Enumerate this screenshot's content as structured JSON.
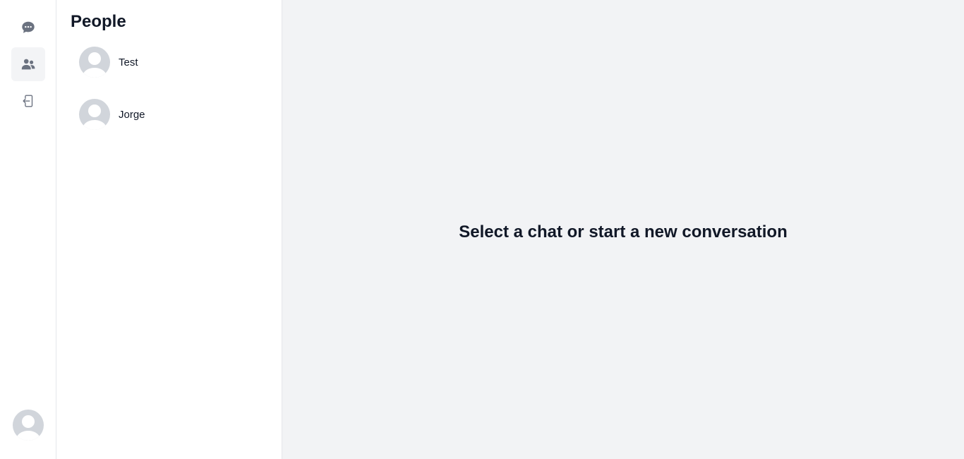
{
  "rail": {
    "items": [
      {
        "name": "chats",
        "icon": "chat-bubble-icon",
        "active": false
      },
      {
        "name": "people",
        "icon": "users-icon",
        "active": true
      },
      {
        "name": "logout",
        "icon": "logout-icon",
        "active": false
      }
    ],
    "user_avatar_icon": "user-avatar-icon"
  },
  "people": {
    "title": "People",
    "items": [
      {
        "name": "Test"
      },
      {
        "name": "Jorge"
      }
    ]
  },
  "main": {
    "empty_message": "Select a chat or start a new conversation"
  },
  "colors": {
    "icon": "#6b7280",
    "avatar_bg": "#d1d5db",
    "active_bg": "#f3f4f6",
    "main_bg": "#f2f3f5"
  }
}
